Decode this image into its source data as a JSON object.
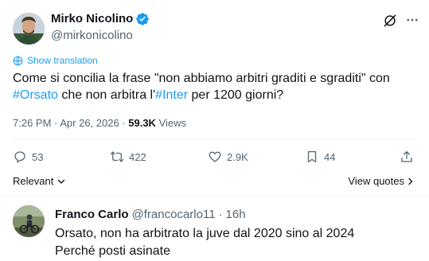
{
  "tweet": {
    "author_name": "Mirko Nicolino",
    "author_handle": "@mirkonicolino",
    "show_translation": "Show translation",
    "text_part1": "Come si concilia la frase \"non abbiamo arbitri graditi e sgraditi\" con",
    "hashtag1": "#Orsato",
    "text_part2": " che non arbitra l'",
    "hashtag2": "#Inter",
    "text_part3": " per 1200 giorni?",
    "timestamp": "7:26 PM · Apr 26, 2026 · ",
    "views_count": "59.3K",
    "views_label": " Views"
  },
  "actions": {
    "replies": "53",
    "retweets": "422",
    "likes": "2.9K",
    "bookmarks": "44"
  },
  "sort": {
    "label": "Relevant"
  },
  "view_quotes": "View quotes",
  "reply": {
    "name": "Franco Carlo",
    "handle": "@francocarlo11",
    "separator": "·",
    "time": "16h",
    "line1": "Orsato, non ha arbitrato la juve dal 2020 sino al 2024",
    "line2": "Perché posti asinate"
  },
  "colors": {
    "accent": "#1d9bf0",
    "text": "#0f1419",
    "secondary": "#536471",
    "divider": "#eff3f4"
  },
  "icons": [
    "verified-badge-icon",
    "grok-icon",
    "more-icon",
    "translate-icon",
    "reply-icon",
    "retweet-icon",
    "like-icon",
    "bookmark-icon",
    "share-icon",
    "chevron-down-icon",
    "chevron-right-icon"
  ]
}
